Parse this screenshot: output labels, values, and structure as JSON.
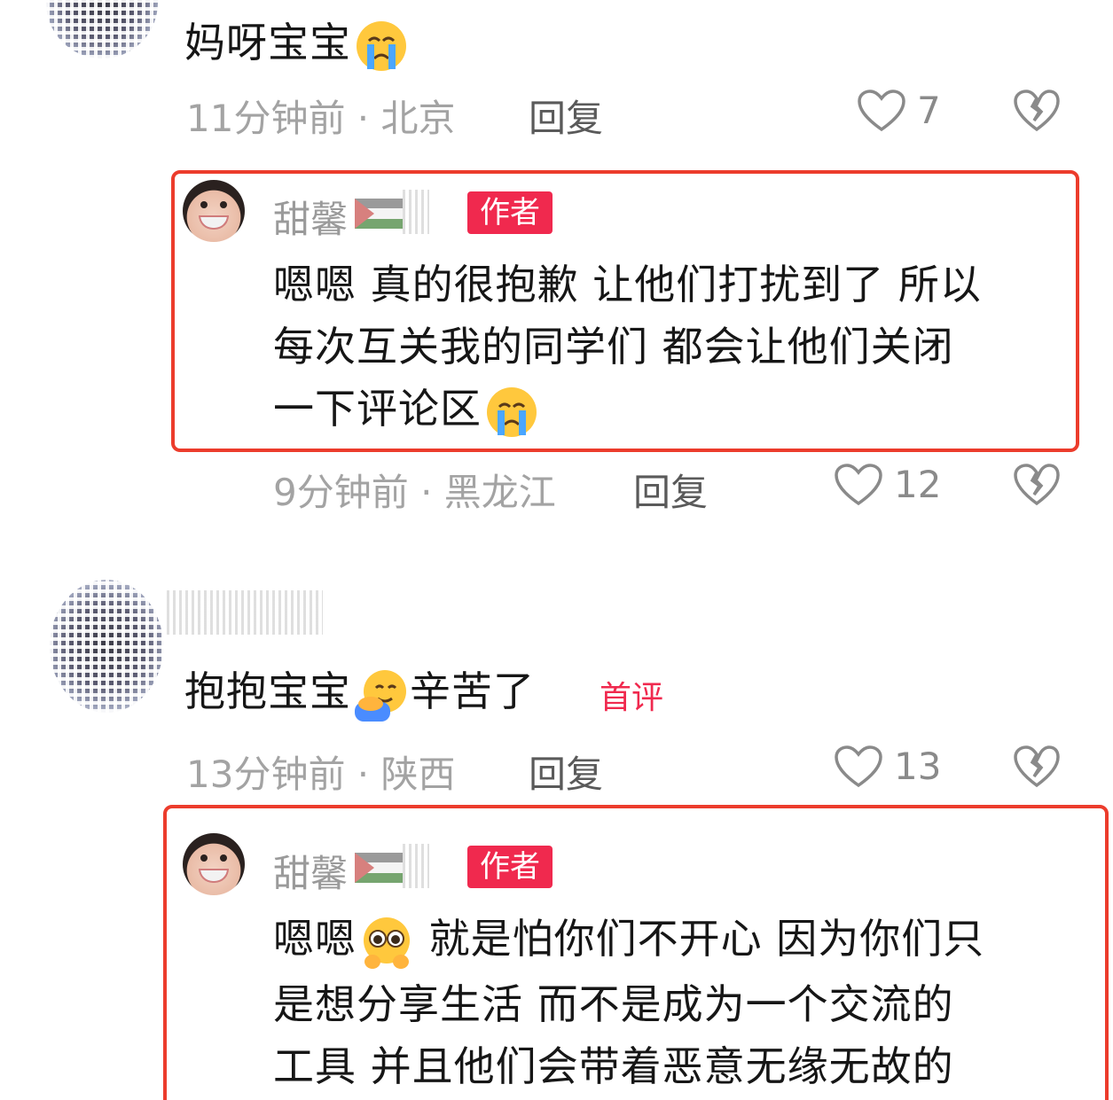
{
  "comment1": {
    "text": "妈呀宝宝",
    "emoji": "crying-face-icon",
    "time": "11分钟前",
    "location": "北京",
    "reply_label": "回复",
    "likes": "7"
  },
  "reply1": {
    "author": "甜馨",
    "badge": "作者",
    "lines": [
      "嗯嗯 真的很抱歉 让他们打扰到了 所以",
      "每次互关我的同学们 都会让他们关闭",
      "一下评论区"
    ],
    "time": "9分钟前",
    "location": "黑龙江",
    "reply_label": "回复",
    "likes": "12"
  },
  "comment2": {
    "text_before": "抱抱宝宝",
    "emoji": "hugging-face-icon",
    "text_after": "辛苦了",
    "badge": "首评",
    "time": "13分钟前",
    "location": "陕西",
    "reply_label": "回复",
    "likes": "13"
  },
  "reply2": {
    "author": "甜馨",
    "badge": "作者",
    "line1_before": "嗯嗯",
    "line1_after": " 就是怕你们不开心 因为你们只",
    "lines": [
      "是想分享生活 而不是成为一个交流的",
      "工具 并且他们会带着恶意无缘无故的"
    ]
  },
  "colors": {
    "highlight": "#ec3c2c",
    "badge": "#f0294e",
    "meta": "#a3a3a3"
  }
}
